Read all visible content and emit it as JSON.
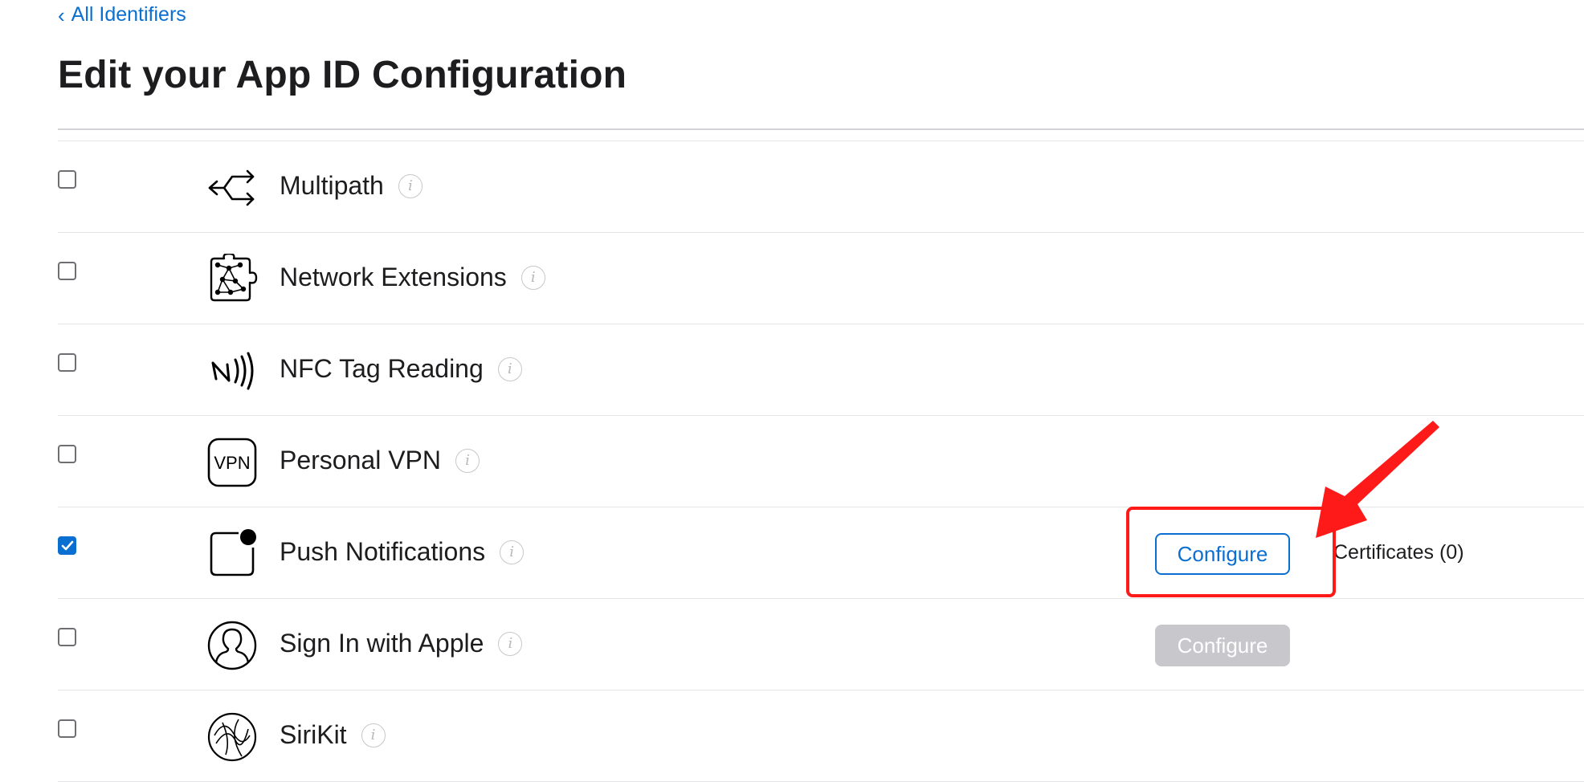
{
  "nav": {
    "back_chevron": "‹",
    "back_label": "All Identifiers"
  },
  "page": {
    "title": "Edit your App ID Configuration"
  },
  "capabilities": [
    {
      "name": "Multipath",
      "icon": "multipath-arrows-icon",
      "checked": false
    },
    {
      "name": "Network Extensions",
      "icon": "network-extensions-icon",
      "checked": false
    },
    {
      "name": "NFC Tag Reading",
      "icon": "nfc-icon",
      "checked": false
    },
    {
      "name": "Personal VPN",
      "icon": "vpn-icon",
      "checked": false,
      "icon_text": "VPN"
    },
    {
      "name": "Push Notifications",
      "icon": "push-notifications-icon",
      "checked": true,
      "configure_label": "Configure",
      "configure_state": "enabled",
      "certificates": "Certificates (0)"
    },
    {
      "name": "Sign In with Apple",
      "icon": "person-icon",
      "checked": false,
      "configure_label": "Configure",
      "configure_state": "disabled"
    },
    {
      "name": "SiriKit",
      "icon": "siri-icon",
      "checked": false
    }
  ],
  "info_glyph": "i",
  "colors": {
    "link": "#0a6fd1",
    "checkbox_checked": "#0a6fd1",
    "annotation": "#ff1a1a",
    "disabled_button": "#c8c8cc"
  },
  "annotation": {
    "type": "red box and arrow pointing at Push Notifications Configure button"
  }
}
